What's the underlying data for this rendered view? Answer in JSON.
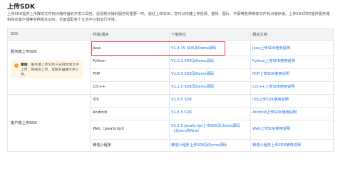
{
  "header": {
    "title": "上传SDK",
    "description": "上传SDK提供上传媒体文件到点播存储的开发工具包，是视频点播的服务的重要一环。通过上传SDK，您可以快捷上传视频、音频、图片、字幕等各种媒体文件到点播存储。上传SDK同时提供服务端和移动客户端等多种版本SDK，全面适配各个主流平台和运行环境。"
  },
  "table": {
    "columns": [
      "SDK",
      "终端/语言",
      "下载地址",
      "相关文档"
    ],
    "groups": {
      "server": "服务端上传SDK",
      "client": "客户端上传SDK"
    },
    "notice": {
      "label": "重要",
      "text": "服务端上传SDK只支持本地文件上传、网络流上传、或服务器端文件上传。"
    },
    "rows": [
      {
        "terminal": "Java",
        "download": "V1.4.15 SDK及Demo源码",
        "doc": "Java上传SDK使用说明"
      },
      {
        "terminal": "Python",
        "download": "V1.0.2 SDK及Demo源码",
        "doc": "Python上传SDK使用说明"
      },
      {
        "terminal": "PHP",
        "download": "V1.0.3 SDK及Demo源码",
        "doc": "PHP上传SDK使用说明"
      },
      {
        "terminal": "C/C++",
        "download": "V1.1.0 SDK及Demo源码",
        "doc": "C/C++上传SDK使用说明"
      },
      {
        "terminal": "iOS",
        "download": "V1.6.5 SDK",
        "doc": "iOS上传SDK使用说明"
      },
      {
        "terminal": "Android",
        "download": "V1.6.5 SDK",
        "doc": "Android上传SDK使用说明"
      },
      {
        "terminal": "Web（JavaScript）",
        "download": "V1.5.5 JavaScript上传SDK及Demo源码（jQuery和Vue）",
        "doc": "Web上传SDK使用说明"
      },
      {
        "terminal": "微信小程序",
        "download": "微信小程序上传SDK及Demo源码",
        "doc": "微信小程序上传SDK使用说明"
      }
    ]
  },
  "colors": {
    "link": "#1a73e8",
    "highlight_border": "#e0474c",
    "notice_bg": "#fff6e6",
    "header_bg": "#f2f3f5"
  }
}
